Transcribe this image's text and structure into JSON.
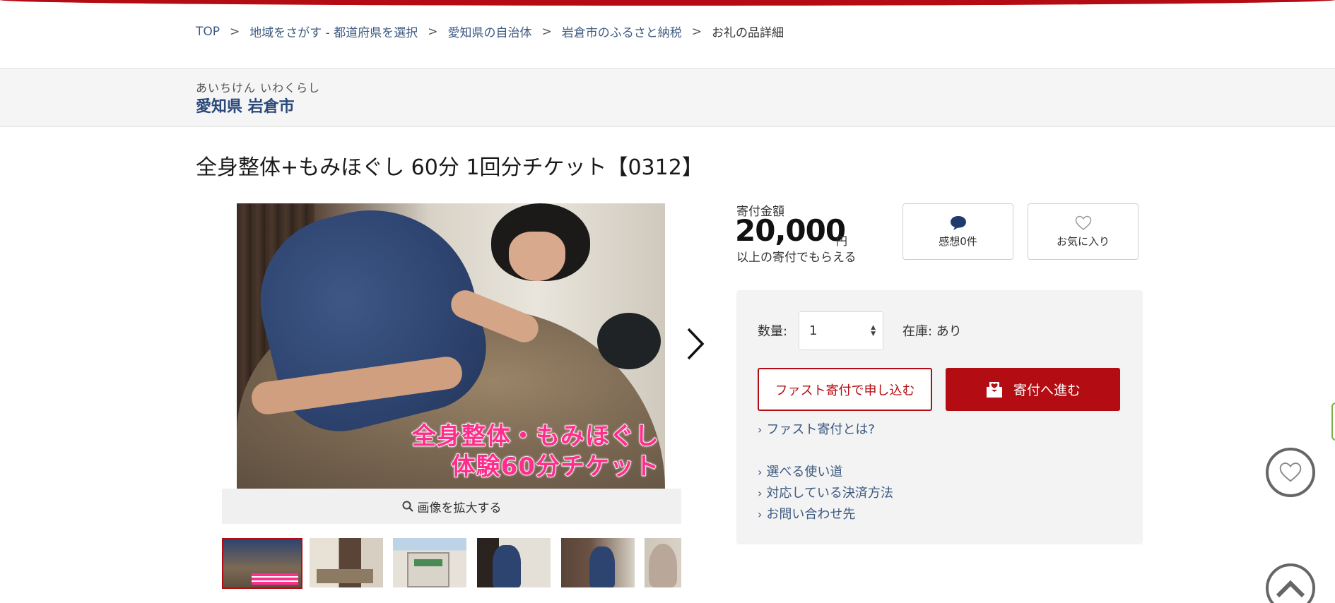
{
  "breadcrumb": {
    "items": [
      "TOP",
      "地域をさがす - 都道府県を選択",
      "愛知県の自治体",
      "岩倉市のふるさと納税",
      "お礼の品詳細"
    ],
    "separator": ">"
  },
  "region": {
    "kana": "あいちけん いわくらし",
    "name": "愛知県 岩倉市"
  },
  "product": {
    "title": "全身整体+もみほぐし 60分 1回分チケット【0312】",
    "image_caption_line1": "全身整体・もみほぐし",
    "image_caption_line2": "体験60分チケット",
    "zoom_label": "画像を拡大する",
    "thumbnail_count": 6
  },
  "donation": {
    "amount_label": "寄付金額",
    "amount": "20,000",
    "currency": "円",
    "amount_note": "以上の寄付でもらえる"
  },
  "actions": {
    "reviews_label": "感想0件",
    "favorite_label": "お気に入り"
  },
  "order": {
    "quantity_label": "数量:",
    "quantity_value": "1",
    "stock_label": "在庫: あり",
    "fast_button": "ファスト寄付で申し込む",
    "donate_button": "寄付へ進む"
  },
  "links": {
    "fast_about": "ファスト寄付とは?",
    "usage": "選べる使い道",
    "payment": "対応している決済方法",
    "contact": "お問い合わせ先"
  },
  "colors": {
    "brand_red": "#b30c12",
    "link_blue": "#3d5a80",
    "region_blue": "#2b4a7a",
    "caption_pink": "#ff2d8c"
  },
  "icons": {
    "next": "chevron-right-icon",
    "zoom": "search-icon",
    "review": "speech-bubble-icon",
    "favorite": "heart-outline-icon",
    "donate": "envelope-heart-icon",
    "back_to_top": "chevron-up-icon"
  }
}
